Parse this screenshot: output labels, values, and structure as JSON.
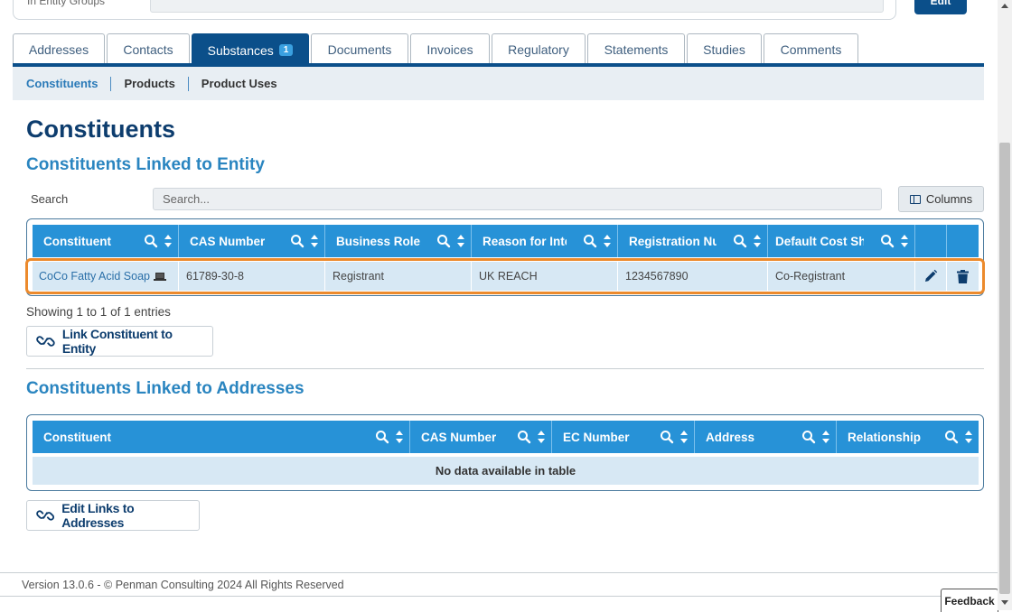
{
  "top": {
    "field_label": "In Entity Groups",
    "button_label": "Edit"
  },
  "tabs": [
    {
      "label": "Addresses"
    },
    {
      "label": "Contacts"
    },
    {
      "label": "Substances",
      "badge": "1",
      "active": true
    },
    {
      "label": "Documents"
    },
    {
      "label": "Invoices"
    },
    {
      "label": "Regulatory"
    },
    {
      "label": "Statements"
    },
    {
      "label": "Studies"
    },
    {
      "label": "Comments"
    }
  ],
  "subnav": [
    "Constituents",
    "Products",
    "Product Uses"
  ],
  "page_title": "Constituents",
  "entity_section": {
    "title": "Constituents Linked to Entity",
    "search_label": "Search",
    "search_placeholder": "Search...",
    "columns_label": "Columns",
    "headers": [
      "Constituent",
      "CAS Number",
      "Business Roles",
      "Reason for Intere",
      "Registration Num",
      "Default Cost Shar"
    ],
    "row": {
      "constituent": "CoCo Fatty Acid Soap",
      "cas": "61789-30-8",
      "role": "Registrant",
      "reason": "UK REACH",
      "registration": "1234567890",
      "cost_share": "Co-Registrant"
    },
    "info": "Showing 1 to 1 of 1 entries",
    "link_button": "Link Constituent to Entity"
  },
  "address_section": {
    "title": "Constituents Linked to Addresses",
    "headers": [
      "Constituent",
      "CAS Number",
      "EC Number",
      "Address",
      "Relationship"
    ],
    "empty": "No data available in table",
    "edit_button": "Edit Links to Addresses"
  },
  "footer": {
    "version": "Version 13.0.6 - © Penman Consulting 2024 All Rights Reserved",
    "feedback": "Feedback"
  },
  "colors": {
    "primary": "#0b4f8a",
    "header": "#2792d7",
    "row": "#d7e8f4",
    "highlight": "#ec8a2c",
    "accent": "#2a85c0"
  },
  "icons": [
    "search-icon",
    "sort-icon",
    "laptop-icon",
    "pencil-icon",
    "trash-icon",
    "link-icon",
    "columns-icon"
  ]
}
